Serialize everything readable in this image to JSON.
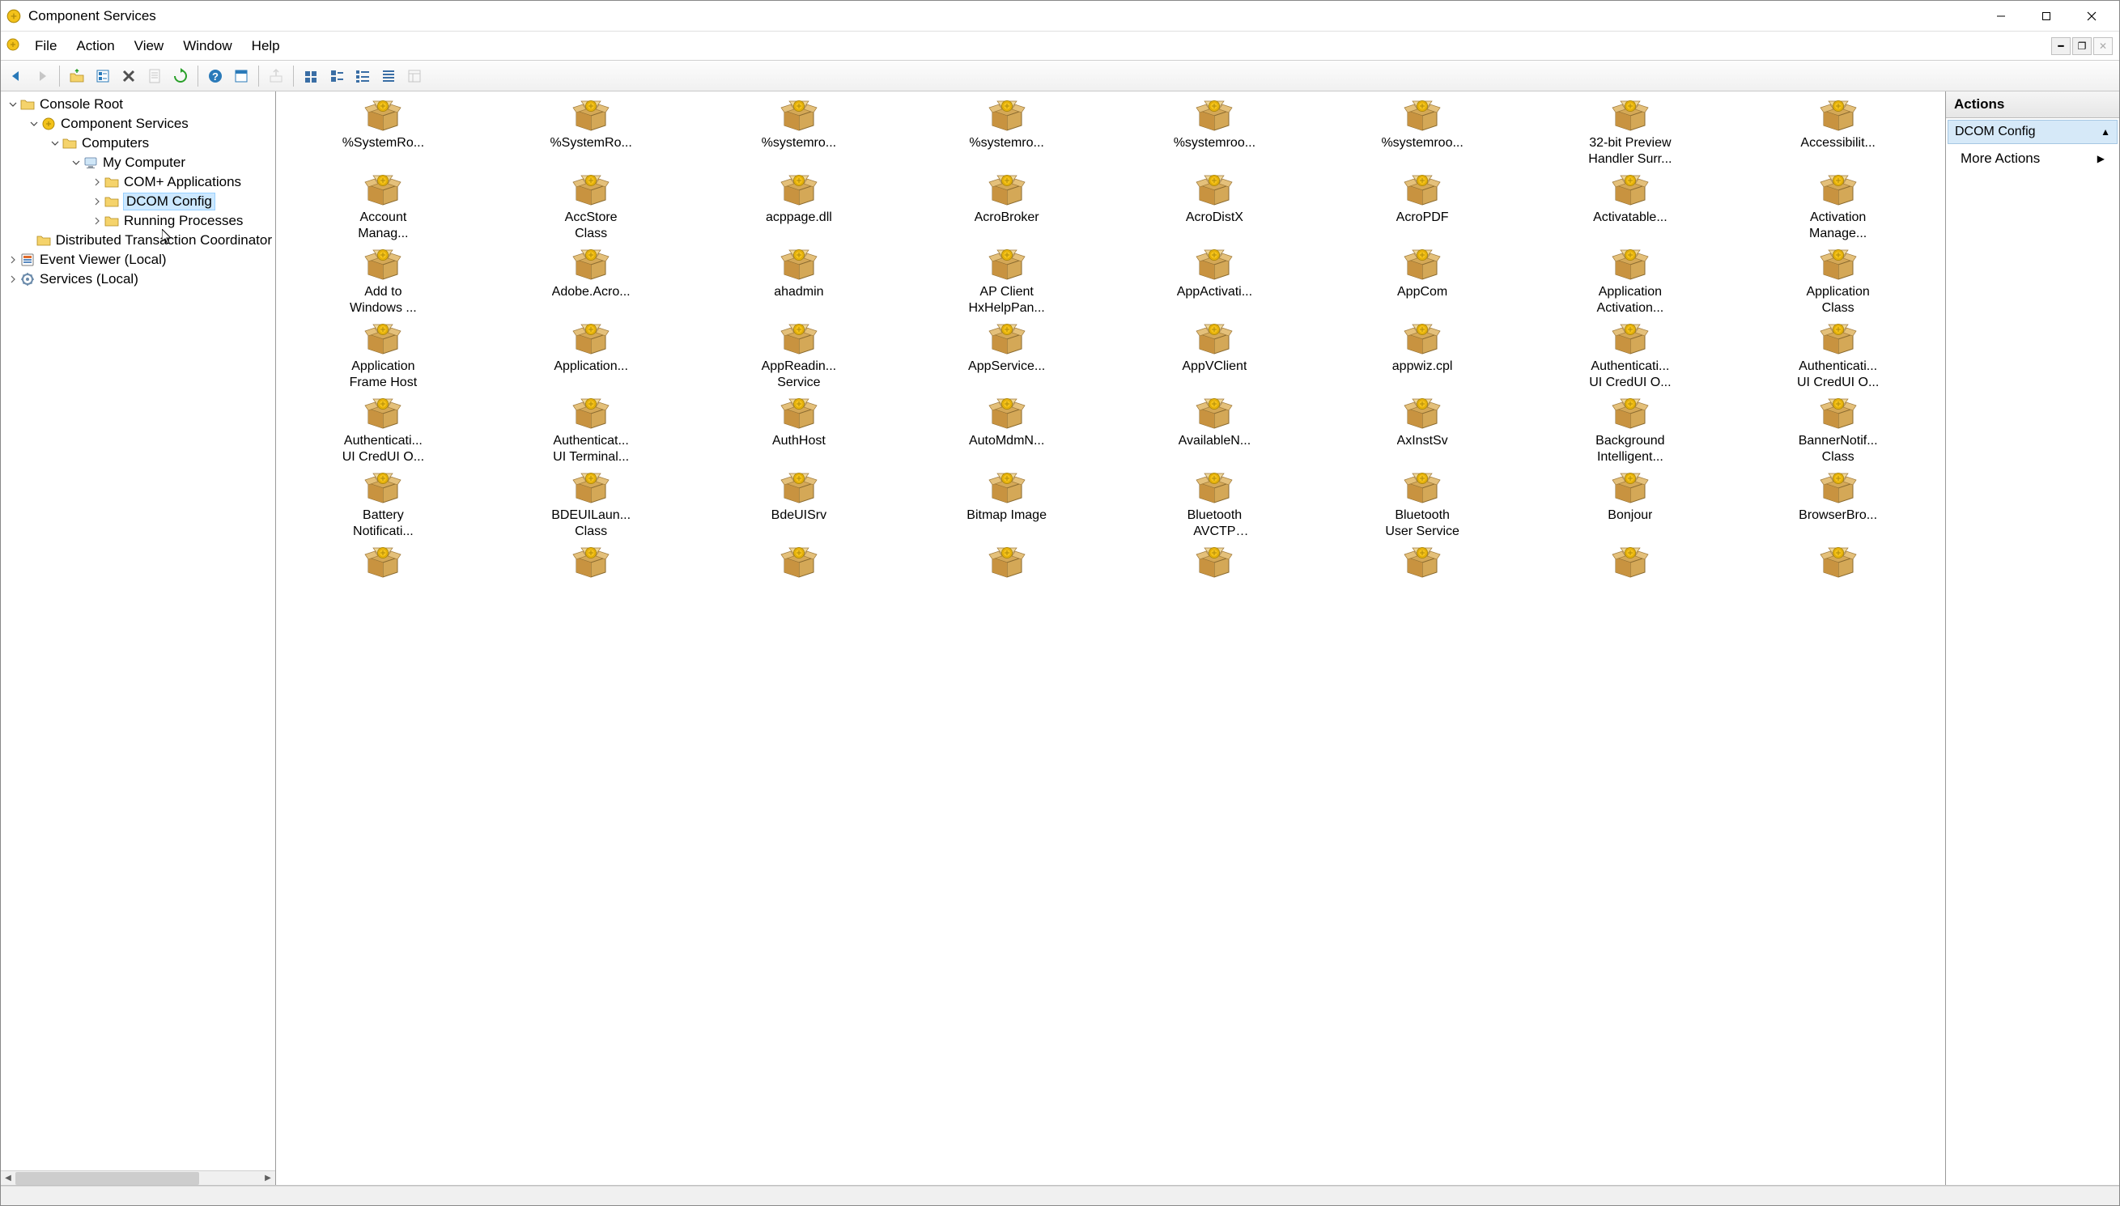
{
  "window": {
    "title": "Component Services"
  },
  "menus": [
    "File",
    "Action",
    "View",
    "Window",
    "Help"
  ],
  "toolbar": [
    {
      "name": "nav-back",
      "icon": "arrow-left",
      "color": "#2a7ab9"
    },
    {
      "name": "nav-forward",
      "icon": "arrow-right",
      "color": "#808080",
      "disabled": true
    },
    {
      "sep": true
    },
    {
      "name": "up-one-level",
      "icon": "folder-up",
      "color": "#e3b23a"
    },
    {
      "name": "show-hide-tree",
      "icon": "tree-toggle",
      "color": "#2a7ab9"
    },
    {
      "name": "delete",
      "icon": "x",
      "color": "#505050"
    },
    {
      "name": "properties",
      "icon": "props",
      "color": "#808080",
      "disabled": true
    },
    {
      "name": "refresh",
      "icon": "refresh",
      "color": "#2aa02a"
    },
    {
      "sep": true
    },
    {
      "name": "help",
      "icon": "help",
      "color": "#2a7ab9"
    },
    {
      "name": "window",
      "icon": "window",
      "color": "#2a7ab9"
    },
    {
      "sep": true
    },
    {
      "name": "export",
      "icon": "export",
      "color": "#a0a0a0",
      "disabled": true
    },
    {
      "sep": true
    },
    {
      "name": "view-status",
      "icon": "status",
      "color": "#3a6ea5"
    },
    {
      "name": "view-shutdown",
      "icon": "shutdown",
      "color": "#3a6ea5"
    },
    {
      "name": "view-local",
      "icon": "local",
      "color": "#3a6ea5"
    },
    {
      "name": "view-list",
      "icon": "list",
      "color": "#3a6ea5"
    },
    {
      "name": "view-detail",
      "icon": "detail",
      "color": "#808080",
      "disabled": true
    }
  ],
  "tree": [
    {
      "indent": 0,
      "expander": "open",
      "icon": "folder",
      "label": "Console Root"
    },
    {
      "indent": 1,
      "expander": "open",
      "icon": "comp-svc",
      "label": "Component Services"
    },
    {
      "indent": 2,
      "expander": "open",
      "icon": "folder",
      "label": "Computers"
    },
    {
      "indent": 3,
      "expander": "open",
      "icon": "computer",
      "label": "My Computer"
    },
    {
      "indent": 4,
      "expander": "closed",
      "icon": "folder",
      "label": "COM+ Applications"
    },
    {
      "indent": 4,
      "expander": "closed",
      "icon": "folder",
      "label": "DCOM Config",
      "selected": true
    },
    {
      "indent": 4,
      "expander": "closed",
      "icon": "folder",
      "label": "Running Processes"
    },
    {
      "indent": 4,
      "expander": "none",
      "icon": "folder",
      "label": "Distributed Transaction Coordinator"
    },
    {
      "indent": 0,
      "expander": "closed",
      "icon": "event",
      "label": "Event Viewer (Local)"
    },
    {
      "indent": 0,
      "expander": "closed",
      "icon": "services",
      "label": "Services (Local)"
    }
  ],
  "grid_items": [
    "%SystemRo...",
    "%SystemRo...",
    "%systemro...",
    "%systemro...",
    "%systemroo...",
    "%systemroo...",
    "32-bit Preview Handler Surr...",
    "Accessibilit...",
    "Account Manag...",
    "AccStore Class",
    "acppage.dll",
    "AcroBroker",
    "AcroDistX",
    "AcroPDF",
    "Activatable...",
    "Activation Manage...",
    "Add to Windows ...",
    "Adobe.Acro...",
    "ahadmin",
    "AP Client HxHelpPan...",
    "AppActivati...",
    "AppCom",
    "Application Activation...",
    "Application Class",
    "Application Frame Host",
    "Application...",
    "AppReadin... Service",
    "AppService...",
    "AppVClient",
    "appwiz.cpl",
    "Authenticati... UI CredUI O...",
    "Authenticati... UI CredUI O...",
    "Authenticati... UI CredUI O...",
    "Authenticat... UI Terminal...",
    "AuthHost",
    "AutoMdmN...",
    "AvailableN...",
    "AxInstSv",
    "Background Intelligent...",
    "BannerNotif... Class",
    "Battery Notificati...",
    "BDEUILaun... Class",
    "BdeUISrv",
    "Bitmap Image",
    "Bluetooth AVCTP Service",
    "Bluetooth User Service",
    "Bonjour",
    "BrowserBro...",
    "",
    "",
    "",
    "",
    "",
    "",
    "",
    ""
  ],
  "actions": {
    "header": "Actions",
    "section": "DCOM Config",
    "links": [
      "More Actions"
    ]
  }
}
